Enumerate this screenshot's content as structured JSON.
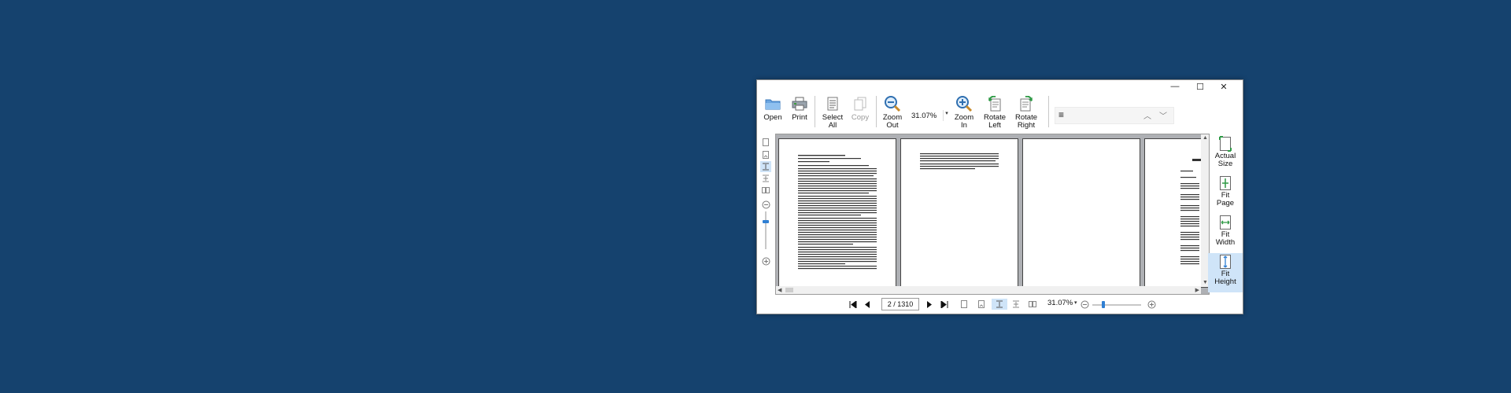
{
  "window": {
    "controls": {
      "minimize": "—",
      "maximize": "☐",
      "close": "✕"
    }
  },
  "toolbar": {
    "open_label": "Open",
    "print_label": "Print",
    "select_all_label": "Select\nAll",
    "copy_label": "Copy",
    "zoom_out_label": "Zoom\nOut",
    "zoom_value": "31.07%",
    "zoom_in_label": "Zoom\nIn",
    "rotate_left_label": "Rotate\nLeft",
    "rotate_right_label": "Rotate\nRight",
    "menu_icon": "≡",
    "search_prev": "︿",
    "search_next": "﹀"
  },
  "right_panel": {
    "actual_size_label": "Actual\nSize",
    "fit_page_label": "Fit\nPage",
    "fit_width_label": "Fit\nWidth",
    "fit_height_label": "Fit\nHeight",
    "active": "fit-height"
  },
  "statusbar": {
    "page_indicator": "2 / 1310",
    "zoom_value": "31.07%",
    "zoom_dropdown": "▾"
  },
  "colors": {
    "desktop": "#15426e",
    "accent": "#2f7fd3",
    "active_bg": "#cfe4f8"
  },
  "icons": [
    "folder-icon",
    "printer-icon",
    "select-all-icon",
    "copy-icon",
    "zoom-out-icon",
    "zoom-in-icon",
    "rotate-left-icon",
    "rotate-right-icon",
    "menu-icon",
    "chevron-up-icon",
    "chevron-down-icon",
    "first-page-icon",
    "prev-page-icon",
    "next-page-icon",
    "last-page-icon",
    "zoom-minus-icon",
    "zoom-plus-icon"
  ]
}
